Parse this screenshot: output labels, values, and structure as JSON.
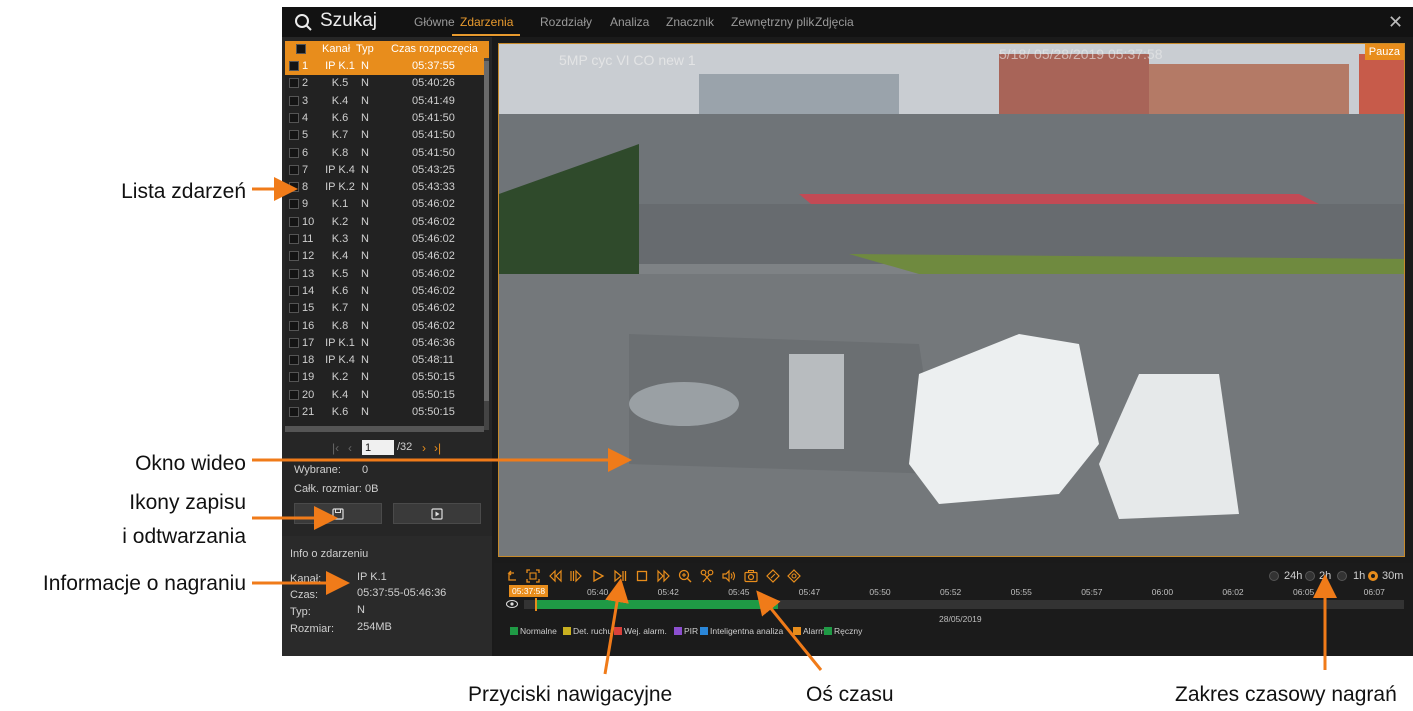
{
  "annotations": {
    "event_list": "Lista zdarzeń",
    "video_window": "Okno wideo",
    "record_icons_line1": "Ikony zapisu",
    "record_icons_line2": "i odtwarzania",
    "recording_info": "Informacje o nagraniu",
    "nav_buttons": "Przyciski nawigacyjne",
    "timeline": "Oś czasu",
    "time_range": "Zakres czasowy nagrań"
  },
  "app": {
    "title": "Szukaj",
    "tabs": [
      "Główne",
      "Zdarzenia",
      "Rozdziały",
      "Analiza",
      "Znacznik",
      "Zewnętrzny plik",
      "Zdjęcia"
    ],
    "active_tab": "Zdarzenia"
  },
  "event_table": {
    "headers": {
      "channel": "Kanał",
      "type": "Typ",
      "start_time": "Czas rozpoczęcia"
    },
    "rows": [
      {
        "n": "1",
        "ch": "IP K.1",
        "type": "N",
        "time": "05:37:55"
      },
      {
        "n": "2",
        "ch": "K.5",
        "type": "N",
        "time": "05:40:26"
      },
      {
        "n": "3",
        "ch": "K.4",
        "type": "N",
        "time": "05:41:49"
      },
      {
        "n": "4",
        "ch": "K.6",
        "type": "N",
        "time": "05:41:50"
      },
      {
        "n": "5",
        "ch": "K.7",
        "type": "N",
        "time": "05:41:50"
      },
      {
        "n": "6",
        "ch": "K.8",
        "type": "N",
        "time": "05:41:50"
      },
      {
        "n": "7",
        "ch": "IP K.4",
        "type": "N",
        "time": "05:43:25"
      },
      {
        "n": "8",
        "ch": "IP K.2",
        "type": "N",
        "time": "05:43:33"
      },
      {
        "n": "9",
        "ch": "K.1",
        "type": "N",
        "time": "05:46:02"
      },
      {
        "n": "10",
        "ch": "K.2",
        "type": "N",
        "time": "05:46:02"
      },
      {
        "n": "11",
        "ch": "K.3",
        "type": "N",
        "time": "05:46:02"
      },
      {
        "n": "12",
        "ch": "K.4",
        "type": "N",
        "time": "05:46:02"
      },
      {
        "n": "13",
        "ch": "K.5",
        "type": "N",
        "time": "05:46:02"
      },
      {
        "n": "14",
        "ch": "K.6",
        "type": "N",
        "time": "05:46:02"
      },
      {
        "n": "15",
        "ch": "K.7",
        "type": "N",
        "time": "05:46:02"
      },
      {
        "n": "16",
        "ch": "K.8",
        "type": "N",
        "time": "05:46:02"
      },
      {
        "n": "17",
        "ch": "IP K.1",
        "type": "N",
        "time": "05:46:36"
      },
      {
        "n": "18",
        "ch": "IP K.4",
        "type": "N",
        "time": "05:48:11"
      },
      {
        "n": "19",
        "ch": "K.2",
        "type": "N",
        "time": "05:50:15"
      },
      {
        "n": "20",
        "ch": "K.4",
        "type": "N",
        "time": "05:50:15"
      },
      {
        "n": "21",
        "ch": "K.6",
        "type": "N",
        "time": "05:50:15"
      }
    ],
    "selected_row": "1"
  },
  "pager": {
    "current": "1",
    "total": "/32"
  },
  "selection": {
    "selected_label": "Wybrane:",
    "selected_value": "0",
    "total_size_label": "Całk. rozmiar:",
    "total_size_value": "0B"
  },
  "event_info": {
    "title": "Info o zdarzeniu",
    "channel_label": "Kanał:",
    "channel_value": "IP K.1",
    "time_label": "Czas:",
    "time_value": "05:37:55-05:46:36",
    "type_label": "Typ:",
    "type_value": "N",
    "size_label": "Rozmiar:",
    "size_value": "254MB"
  },
  "video": {
    "status": "Pauza",
    "osd_text": "5MP cyc VI CO new 1",
    "osd_time": "5/18/ 05/28/2019 05:37:58"
  },
  "controls": {
    "nav_icons": [
      "back-icon",
      "fullscreen-icon",
      "rewind-icon",
      "slow-icon",
      "play-icon",
      "step-icon",
      "stop-icon",
      "fast-forward-icon",
      "zoom-icon",
      "clip-icon",
      "audio-icon",
      "snapshot-icon",
      "tag-icon",
      "custom-tag-icon"
    ],
    "ranges": [
      "24h",
      "2h",
      "1h",
      "30m"
    ],
    "selected_range": "30m",
    "current_time": "05:37:58",
    "ticks": [
      "05:40",
      "05:42",
      "05:45",
      "05:47",
      "05:50",
      "05:52",
      "05:55",
      "05:57",
      "06:00",
      "06:02",
      "06:05",
      "06:07"
    ],
    "date": "28/05/2019",
    "playback_position": 0.012,
    "recorded_fraction": 0.277,
    "legend": [
      {
        "label": "Normalne",
        "color": "#1f9a45"
      },
      {
        "label": "Det. ruchu",
        "color": "#c9b020"
      },
      {
        "label": "Wej. alarm.",
        "color": "#d9413b"
      },
      {
        "label": "PIR",
        "color": "#8c4fd0"
      },
      {
        "label": "Inteligentna analiza",
        "color": "#2a86d8"
      },
      {
        "label": "Alarm",
        "color": "#e88d1c"
      },
      {
        "label": "Ręczny",
        "color": "#1f9a45"
      }
    ]
  },
  "colors": {
    "accent": "#e88d1c",
    "annotation_arrow": "#f07b19"
  }
}
